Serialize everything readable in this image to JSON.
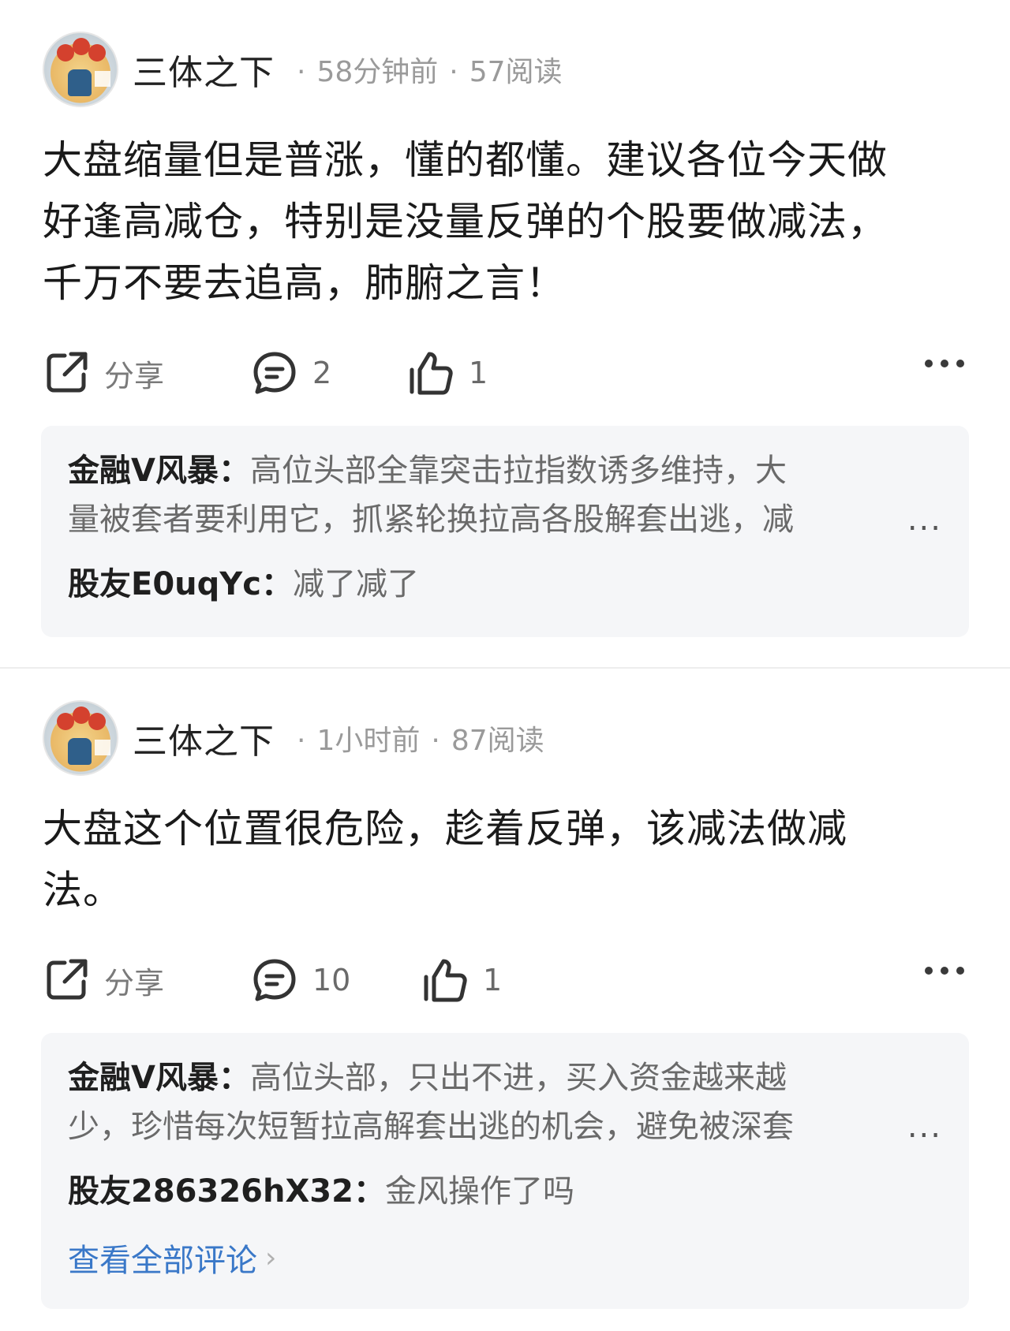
{
  "posts": [
    {
      "author": "三体之下",
      "time": "58分钟前",
      "reads": "57阅读",
      "content": [
        "大盘缩量但是普涨，懂的都懂。建议各位今天做",
        "好逢高减仓，特别是没量反弹的个股要做减法，",
        "千万不要去追高，肺腑之言！"
      ],
      "share_label": "分享",
      "comment_count": "2",
      "like_count": "1",
      "comments": [
        {
          "name": "金融V风暴：",
          "text_line1": "高位头部全靠突击拉指数诱多维持，大",
          "text_line2": "量被套者要利用它，抓紧轮换拉高各股解套出逃，减",
          "ellipsis": "..."
        },
        {
          "name": "股友E0uqYc：",
          "text_line1": "减了减了"
        }
      ]
    },
    {
      "author": "三体之下",
      "time": "1小时前",
      "reads": "87阅读",
      "content": [
        "大盘这个位置很危险，趁着反弹，该减法做减",
        "法。"
      ],
      "share_label": "分享",
      "comment_count": "10",
      "like_count": "1",
      "comments": [
        {
          "name": "金融V风暴：",
          "text_line1": "高位头部，只出不进，买入资金越来越",
          "text_line2": "少，珍惜每次短暂拉高解套出逃的机会，避免被深套",
          "ellipsis": "..."
        },
        {
          "name": "股友286326hX32：",
          "text_line1": "金风操作了吗"
        }
      ],
      "view_all": "查看全部评论",
      "view_all_chevron": "›"
    }
  ],
  "meta_separator": "·",
  "icons": {
    "share": "share-icon",
    "comment": "comment-icon",
    "like": "thumbs-up-icon",
    "more": "more-icon"
  }
}
